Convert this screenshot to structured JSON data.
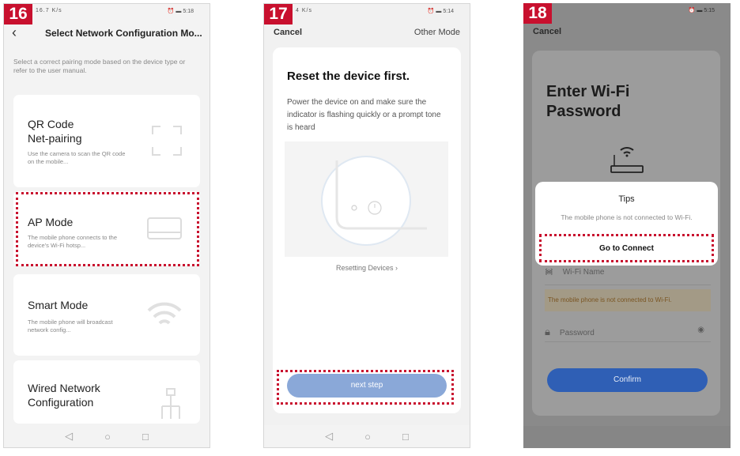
{
  "panel1": {
    "step": "16",
    "status": {
      "left": "16.7 K/s",
      "time": "5:18"
    },
    "title": "Select Network Configuration Mo...",
    "hint": "Select a correct pairing mode based on the device type or refer to the user manual.",
    "cards": [
      {
        "name_line1": "QR Code",
        "name_line2": "Net-pairing",
        "desc": "Use the camera to scan the QR code on the mobile...",
        "icon": "scan-frame-icon"
      },
      {
        "name_line1": "AP Mode",
        "name_line2": "",
        "desc": "The mobile phone connects to the device's Wi-Fi hotsp...",
        "icon": "router-icon"
      },
      {
        "name_line1": "Smart Mode",
        "name_line2": "",
        "desc": "The mobile phone will broadcast network config...",
        "icon": "wifi-icon"
      },
      {
        "name_line1": "Wired Network",
        "name_line2": "Configuration",
        "desc": "",
        "icon": "wired-network-icon"
      }
    ]
  },
  "panel2": {
    "step": "17",
    "status": {
      "left": "4 K/s",
      "time": "5:14"
    },
    "cancel": "Cancel",
    "other_mode": "Other Mode",
    "heading": "Reset the device first.",
    "desc": "Power the device on and make sure the indicator is flashing quickly or a prompt tone is heard",
    "link": "Resetting Devices",
    "next": "next step"
  },
  "panel3": {
    "step": "18",
    "status": {
      "time": "5:15"
    },
    "cancel": "Cancel",
    "heading_line1": "Enter Wi-Fi",
    "heading_line2": "Password",
    "wifi_name": "Wi-Fi Name",
    "warning": "The mobile phone is not connected to Wi-Fi.",
    "password": "Password",
    "confirm": "Confirm",
    "dialog": {
      "title": "Tips",
      "message": "The mobile phone is not connected to Wi-Fi.",
      "button": "Go to Connect"
    }
  },
  "nav": {
    "back": "◁",
    "home": "○",
    "recent": "□"
  },
  "colors": {
    "marker": "#c8102e",
    "next_button": "#8aa8d8",
    "confirm_button": "#2f5fb5"
  }
}
